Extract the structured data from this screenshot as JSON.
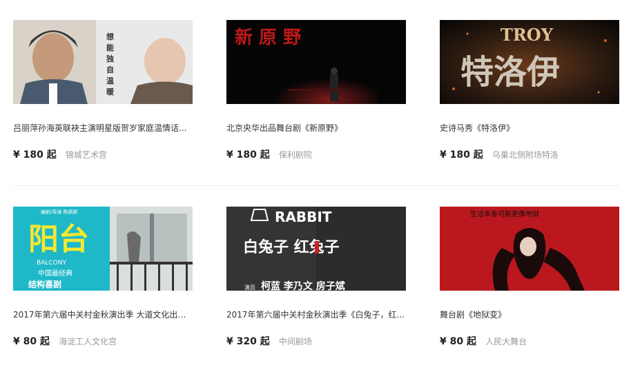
{
  "items": [
    {
      "title": "吕丽萍孙海英联袂主演明星版贺岁家庭温情话...",
      "price": "¥ 180 起",
      "venue": "锦城艺术宫",
      "poster_text": "想能独自温暖"
    },
    {
      "title": "北京央华出品舞台剧《新原野》",
      "price": "¥ 180 起",
      "venue": "保利剧院",
      "poster_text": "新 原 野"
    },
    {
      "title": "史诗马秀《特洛伊》",
      "price": "¥ 180 起",
      "venue": "乌巢北侧附场特洛",
      "poster_text": "TROY",
      "poster_text_cn": "特洛伊"
    },
    {
      "title": "2017年第六届中关村金秋演出季 大道文化出品...",
      "price": "¥ 80 起",
      "venue": "海淀工人文化宫",
      "poster_text": "阳台",
      "poster_text_en": "BALCONY",
      "poster_sub1": "中国最经典",
      "poster_sub2": "结构喜剧",
      "poster_credit": "编剧/导演  陈佩斯"
    },
    {
      "title": "2017年第六届中关村金秋演出季《白兔子，红...",
      "price": "¥ 320 起",
      "venue": "中间剧场",
      "poster_text": "RABBIT",
      "poster_text_cn": "白兔子 红兔子",
      "poster_cast_label": "演员",
      "poster_cast": "柯蓝  李乃文  房子斌"
    },
    {
      "title": "舞台剧《地狱变》",
      "price": "¥ 80 起",
      "venue": "人民大舞台",
      "poster_text": "生活本身可能更像地狱"
    }
  ]
}
